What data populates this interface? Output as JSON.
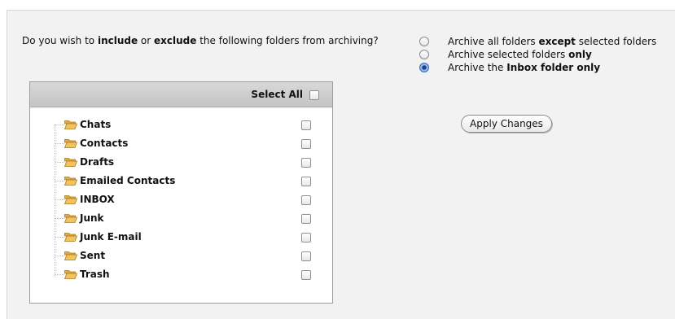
{
  "question": {
    "prefix": "Do you wish to ",
    "include": "include",
    "or": " or ",
    "exclude": "exclude",
    "suffix": " the following folders from archiving?"
  },
  "options": [
    {
      "pre": "Archive all folders ",
      "bold": "except",
      "post": " selected folders",
      "checked": false
    },
    {
      "pre": "Archive selected folders ",
      "bold": "only",
      "post": "",
      "checked": false
    },
    {
      "pre": "Archive the ",
      "bold": "Inbox folder only",
      "post": "",
      "checked": true
    }
  ],
  "apply_label": "Apply Changes",
  "select_all_label": "Select All",
  "folders": [
    {
      "name": "Chats"
    },
    {
      "name": "Contacts"
    },
    {
      "name": "Drafts"
    },
    {
      "name": "Emailed Contacts"
    },
    {
      "name": "INBOX"
    },
    {
      "name": "Junk"
    },
    {
      "name": "Junk E-mail"
    },
    {
      "name": "Sent"
    },
    {
      "name": "Trash"
    }
  ],
  "colors": {
    "panel_bg": "#f2f2f2",
    "radio_selected": "#3a6fc2",
    "folder_icon": "#f2c55c"
  }
}
